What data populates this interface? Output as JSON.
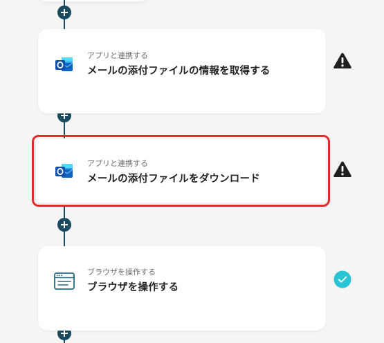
{
  "steps": [
    {
      "app_icon": "outlook-icon",
      "subtitle": "アプリと連携する",
      "title": "メールの添付ファイルの情報を取得する",
      "status": "warning-icon"
    },
    {
      "app_icon": "outlook-icon",
      "subtitle": "アプリと連携する",
      "title": "メールの添付ファイルをダウンロード",
      "status": "warning-icon",
      "selected": true
    },
    {
      "app_icon": "browser-icon",
      "subtitle": "ブラウザを操作する",
      "title": "ブラウザを操作する",
      "status": "check-icon"
    }
  ],
  "colors": {
    "connector": "#1a4a5e",
    "selection": "#e12a2a",
    "warning": "#1f1f1f",
    "check": "#29c5d6",
    "outlook_blue": "#0a64c8",
    "browser_teal": "#1f6a80"
  }
}
